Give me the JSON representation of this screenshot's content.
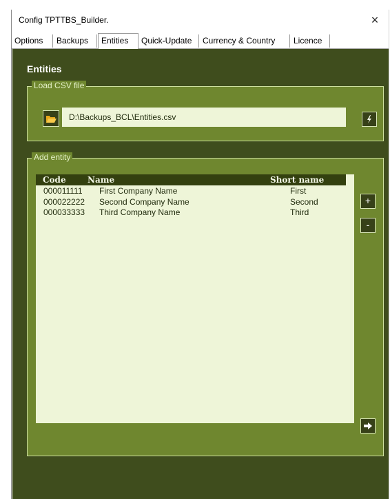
{
  "window": {
    "title": "Config TPTTBS_Builder.",
    "close_icon": "×"
  },
  "tabs": [
    {
      "label": "Options"
    },
    {
      "label": "Backups"
    },
    {
      "label": "Entities"
    },
    {
      "label": "Quick-Update"
    },
    {
      "label": "Currency & Country"
    },
    {
      "label": "Licence"
    }
  ],
  "active_tab": "Entities",
  "panel": {
    "heading": "Entities",
    "load_csv": {
      "label": "Load CSV file",
      "path": "D:\\Backups_BCL\\Entities.csv",
      "folder_icon": "folder-open-icon",
      "load_icon": "lightning-icon"
    },
    "add_entity": {
      "label": "Add entity",
      "columns": {
        "code": "Code",
        "name": "Name",
        "short": "Short name"
      },
      "rows": [
        {
          "code": "000011111",
          "name": "First Company Name",
          "short": "First"
        },
        {
          "code": "000022222",
          "name": "Second Company Name",
          "short": "Second"
        },
        {
          "code": "000033333",
          "name": "Third Company Name",
          "short": "Third"
        }
      ],
      "add_label": "+",
      "remove_label": "-",
      "apply_icon": "arrow-right-icon"
    }
  },
  "colors": {
    "panel_bg": "#3f4d1d",
    "group_bg": "#6f872f",
    "list_bg": "#eef5d8",
    "header_bg": "#33400f"
  }
}
